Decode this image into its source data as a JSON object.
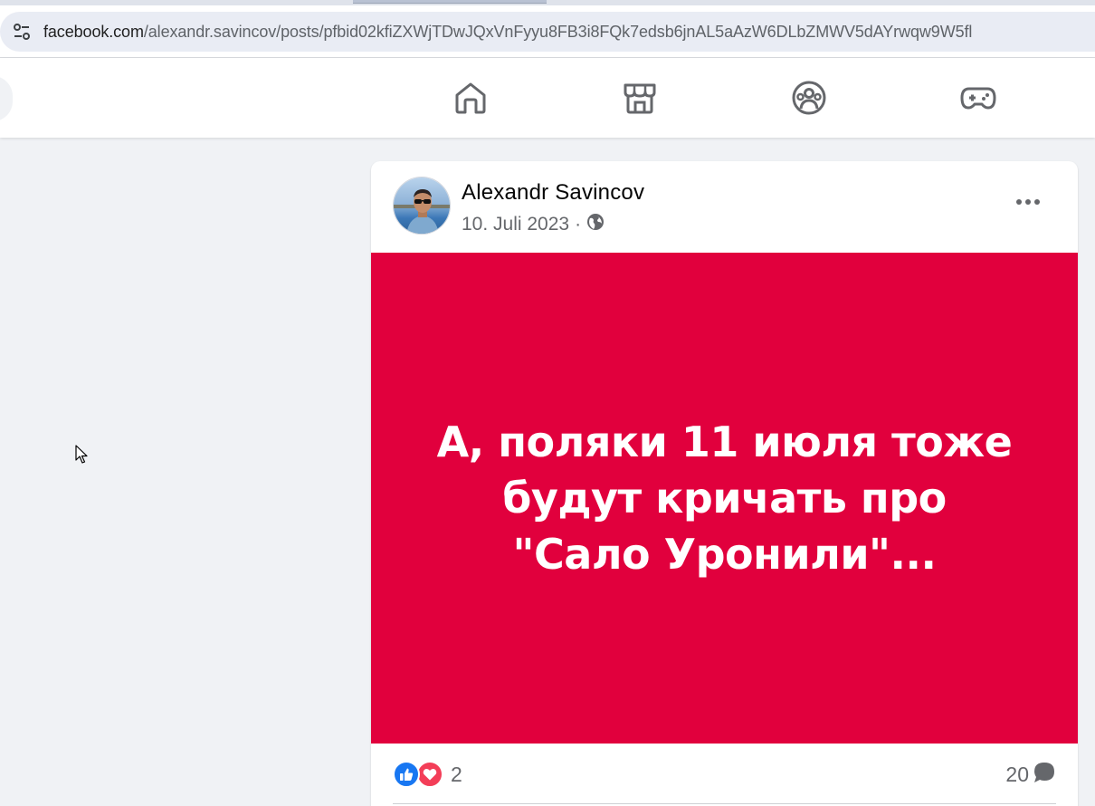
{
  "browser": {
    "url_host": "facebook.com",
    "url_path": "/alexandr.savincov/posts/pfbid02kfiZXWjTDwJQxVnFyyu8FB3i8FQk7edsb6jnAL5aAzW6DLbZMWV5dAYrwqw9W5fl",
    "site_info_icon": "tune-icon"
  },
  "nav": {
    "items": [
      {
        "name": "home-icon"
      },
      {
        "name": "marketplace-icon"
      },
      {
        "name": "groups-icon"
      },
      {
        "name": "gaming-icon"
      }
    ]
  },
  "post": {
    "author": "Alexandr Savincov",
    "date": "10. Juli 2023",
    "separator": "·",
    "audience_icon": "globe-icon",
    "more_icon": "more-dots-icon",
    "image_text": "А, поляки 11 июля тоже будут кричать про \"Сало Уронили\"...",
    "image_background": "#e1003d",
    "reactions": {
      "icons": [
        "like-icon",
        "love-icon"
      ],
      "count": "2"
    },
    "comments": {
      "count": "20",
      "icon": "comment-icon"
    }
  },
  "colors": {
    "page_background": "#f0f2f5",
    "text_secondary": "#65676b",
    "like_blue": "#1877f2",
    "love_red": "#f33e58"
  }
}
